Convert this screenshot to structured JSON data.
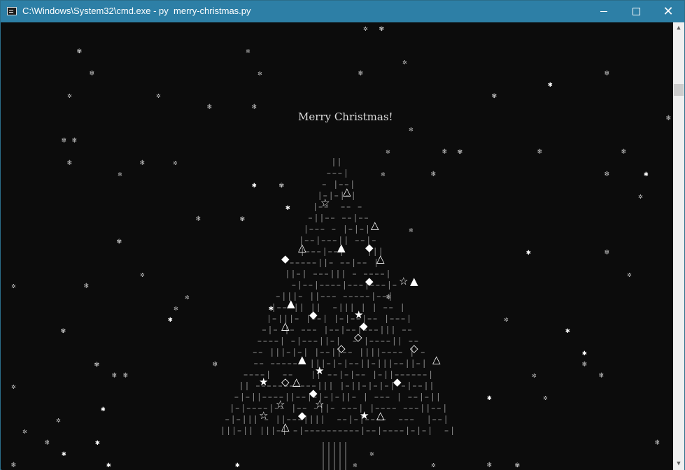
{
  "window": {
    "title": "C:\\Windows\\System32\\cmd.exe - py  merry-christmas.py",
    "icon": "console-icon",
    "controls": {
      "minimize": "minimize-icon",
      "maximize": "maximize-icon",
      "close": "close-icon"
    }
  },
  "console": {
    "background": "#0c0c0c",
    "text_color": "#cccccc",
    "greeting": "Merry Christmas!",
    "tree_trunk_glyph": "|",
    "tree_branch_glyph": "-",
    "ornament_glyphs": [
      "△",
      "▲",
      "☆",
      "★",
      "◇",
      "◆"
    ],
    "snow_glyphs": [
      "❄",
      "✲",
      "✱",
      "✾"
    ]
  },
  "scrollbar": {
    "up": "scroll-up-arrow-icon",
    "down": "scroll-down-arrow-icon"
  }
}
